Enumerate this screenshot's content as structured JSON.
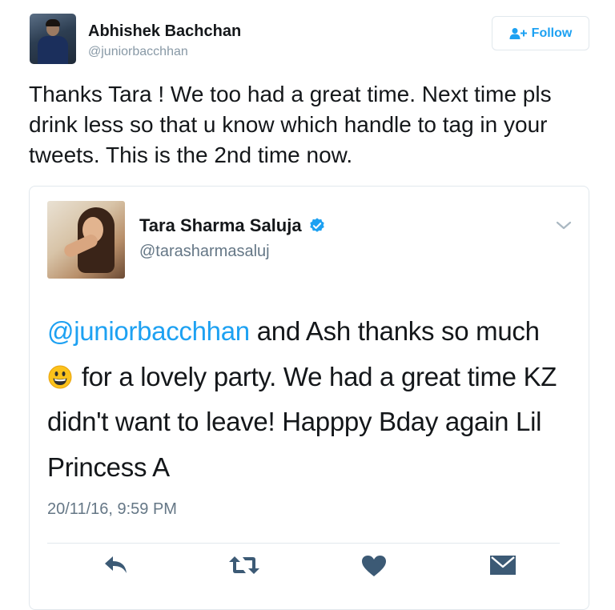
{
  "tweet": {
    "author": {
      "name": "Abhishek Bachchan",
      "handle": "@juniorbacchhan",
      "avatar_icon": "profile-photo"
    },
    "follow_button": {
      "label": "Follow",
      "icon": "person-add-icon",
      "color": "#1da1f2"
    },
    "text": "Thanks Tara ! We too had a great time. Next time pls drink less so that u know which handle to tag in your tweets. This is the 2nd time now."
  },
  "quoted_tweet": {
    "author": {
      "name": "Tara Sharma Saluja",
      "handle": "@tarasharmasaluj",
      "verified": true,
      "avatar_icon": "profile-photo"
    },
    "menu_icon": "chevron-down-icon",
    "text": {
      "mention": "@juniorbacchhan",
      "part1": " and Ash thanks so much",
      "emoji": "grinning-face-emoji",
      "part2": " for a lovely party. We had a great time KZ didn't want to leave! Happpy Bday again Lil Princess A"
    },
    "timestamp": "20/11/16, 9:59 PM",
    "actions": [
      "reply-icon",
      "retweet-icon",
      "like-icon",
      "direct-message-icon"
    ]
  },
  "colors": {
    "link": "#1da1f2",
    "secondary_text": "#657786",
    "action_icons": "#3c5a75",
    "border": "#e1e8ed"
  }
}
